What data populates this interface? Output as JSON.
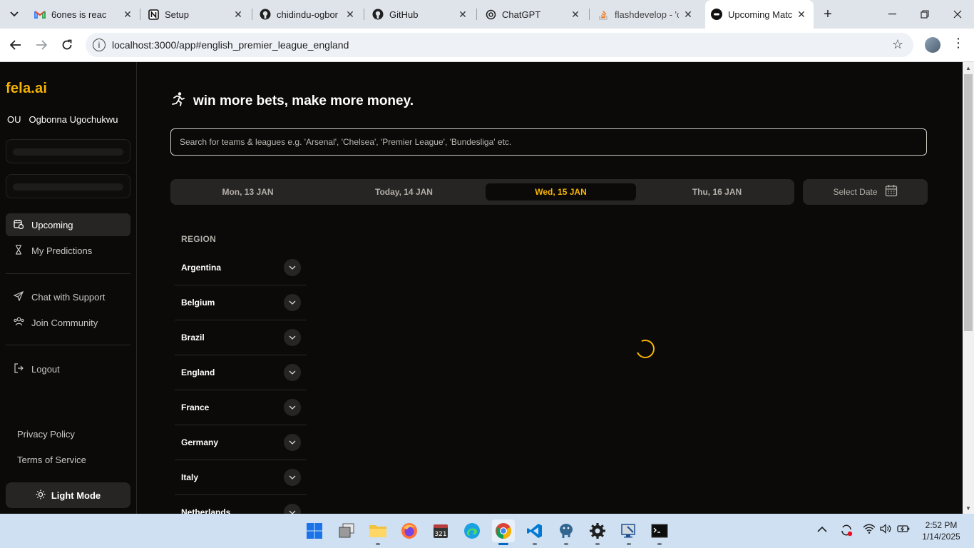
{
  "browser": {
    "tabs": [
      {
        "title": "6ones is reac",
        "icon": "gmail-icon"
      },
      {
        "title": "Setup",
        "icon": "notion-icon"
      },
      {
        "title": "chidindu-ogbon",
        "icon": "github-icon"
      },
      {
        "title": "GitHub",
        "icon": "github-icon"
      },
      {
        "title": "ChatGPT",
        "icon": "chatgpt-icon"
      },
      {
        "title": "flashdevelop - 'c",
        "icon": "stackoverflow-icon"
      },
      {
        "title": "Upcoming Matcl",
        "icon": "fela-icon"
      }
    ],
    "url": "localhost:3000/app#english_premier_league_england"
  },
  "sidebar": {
    "logo": "fela.ai",
    "user_initials": "OU",
    "user_name": "Ogbonna Ugochukwu",
    "nav": {
      "upcoming": "Upcoming",
      "predictions": "My Predictions",
      "support": "Chat with Support",
      "community": "Join Community",
      "logout": "Logout"
    },
    "privacy": "Privacy Policy",
    "terms": "Terms of Service",
    "light_mode": "Light Mode"
  },
  "main": {
    "headline": "win more bets, make more money.",
    "search_placeholder": "Search for teams & leagues e.g. 'Arsenal', 'Chelsea', 'Premier League', 'Bundesliga' etc.",
    "dates": [
      "Mon, 13 JAN",
      "Today, 14 JAN",
      "Wed, 15 JAN",
      "Thu, 16 JAN"
    ],
    "active_date": "Wed, 15 JAN",
    "select_date": "Select Date",
    "region_title": "REGION",
    "regions": [
      "Argentina",
      "Belgium",
      "Brazil",
      "England",
      "France",
      "Germany",
      "Italy",
      "Netherlands"
    ]
  },
  "colors": {
    "accent": "#f5b301",
    "background": "#0b0a09",
    "panel": "#272524"
  },
  "taskbar": {
    "time": "2:52 PM",
    "date": "1/14/2025"
  }
}
